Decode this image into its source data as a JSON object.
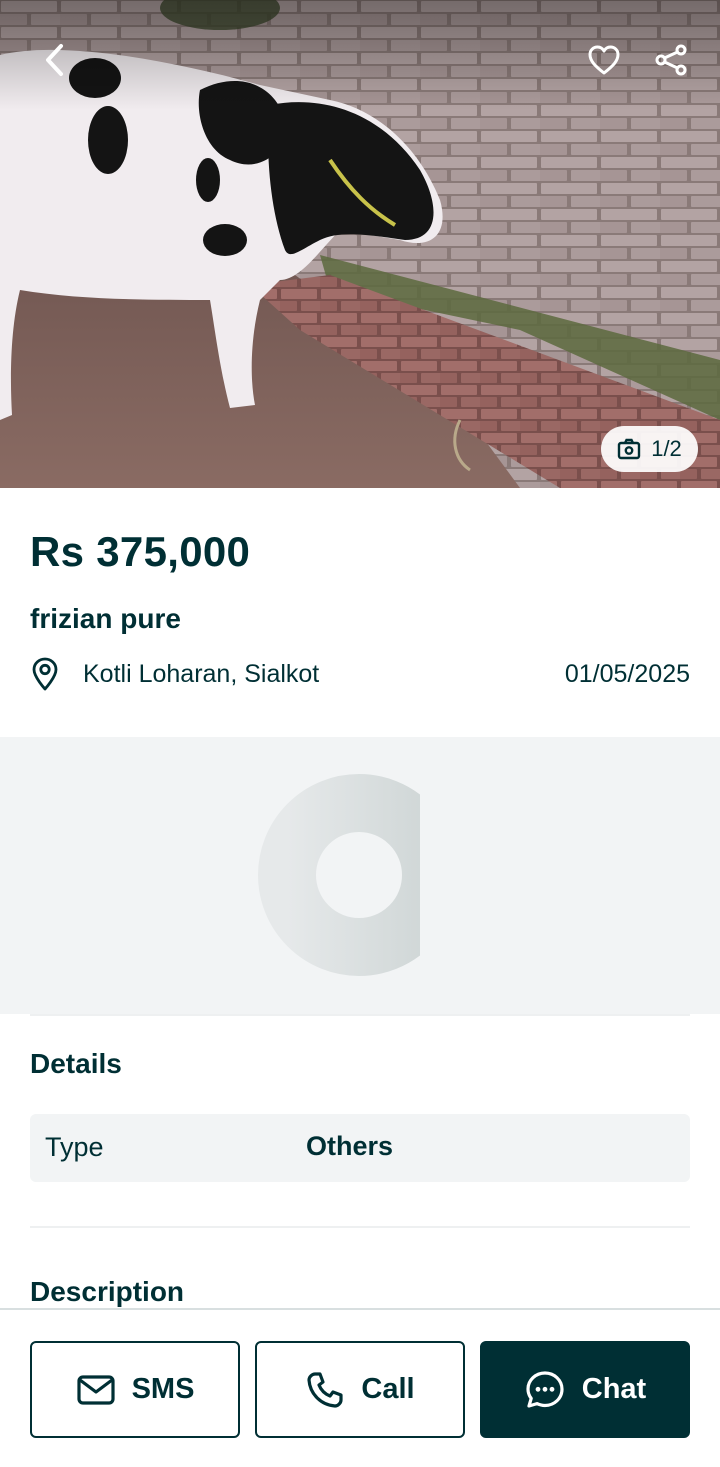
{
  "hero": {
    "image_alt": "Black and white cow standing beside a brick wall",
    "photo_counter": "1/2",
    "icons": {
      "back": "chevron-left-icon",
      "favorite": "heart-icon",
      "share": "share-icon",
      "camera": "camera-icon"
    }
  },
  "listing": {
    "price": "Rs 375,000",
    "title": "frizian pure",
    "location": "Kotli Loharan, Sialkot",
    "date": "01/05/2025"
  },
  "details": {
    "heading": "Details",
    "rows": [
      {
        "key": "Type",
        "value": "Others"
      }
    ]
  },
  "description": {
    "heading": "Description"
  },
  "actions": {
    "sms_label": "SMS",
    "call_label": "Call",
    "chat_label": "Chat"
  },
  "colors": {
    "primary": "#002f34",
    "surface_gray": "#f2f4f5",
    "white": "#ffffff"
  }
}
